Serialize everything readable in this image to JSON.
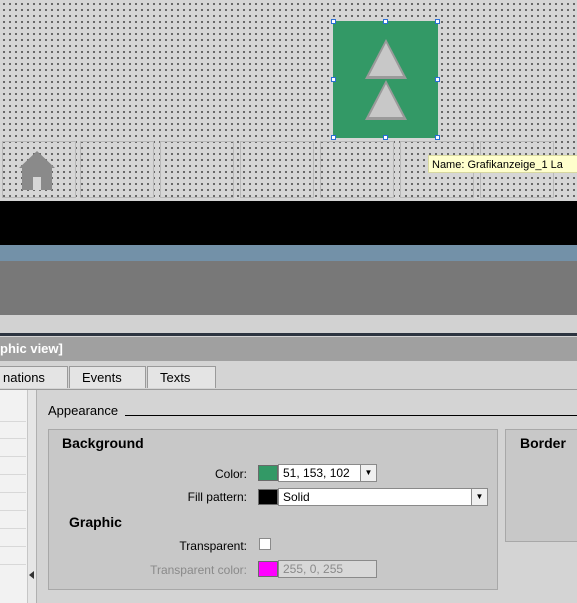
{
  "tooltip": "Name: Grafikanzeige_1   La",
  "panel_title": "phic view]",
  "tabs": [
    {
      "label": "nations"
    },
    {
      "label": "Events"
    },
    {
      "label": "Texts"
    }
  ],
  "section": "Appearance",
  "background": {
    "title": "Background",
    "color_label": "Color:",
    "color_value": "51, 153, 102",
    "color_hex": "#339966",
    "fill_label": "Fill pattern:",
    "fill_value": "Solid",
    "fill_hex": "#000000"
  },
  "graphic": {
    "title": "Graphic",
    "transparent_label": "Transparent:",
    "transparent_color_label": "Transparent color:",
    "transparent_color_value": "255, 0, 255",
    "transparent_color_hex": "#ff00ff"
  },
  "border": {
    "title": "Border"
  }
}
